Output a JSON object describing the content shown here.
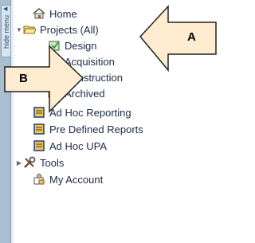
{
  "sidebar": {
    "hide_menu_label": "hide menu"
  },
  "tree": {
    "home": "Home",
    "projects": "Projects (All)",
    "design": "Design",
    "acquisition": "Acquisition",
    "construction": "Construction",
    "archived": "Archived",
    "adhoc_reporting": "Ad Hoc Reporting",
    "predefined_reports": "Pre Defined Reports",
    "adhoc_upa": "Ad Hoc UPA",
    "tools": "Tools",
    "my_account": "My Account"
  },
  "callouts": {
    "a": "A",
    "b": "B"
  },
  "colors": {
    "callout_fill": "#fdeccf",
    "rail": "#a9bfd0",
    "text": "#1c2a44"
  }
}
